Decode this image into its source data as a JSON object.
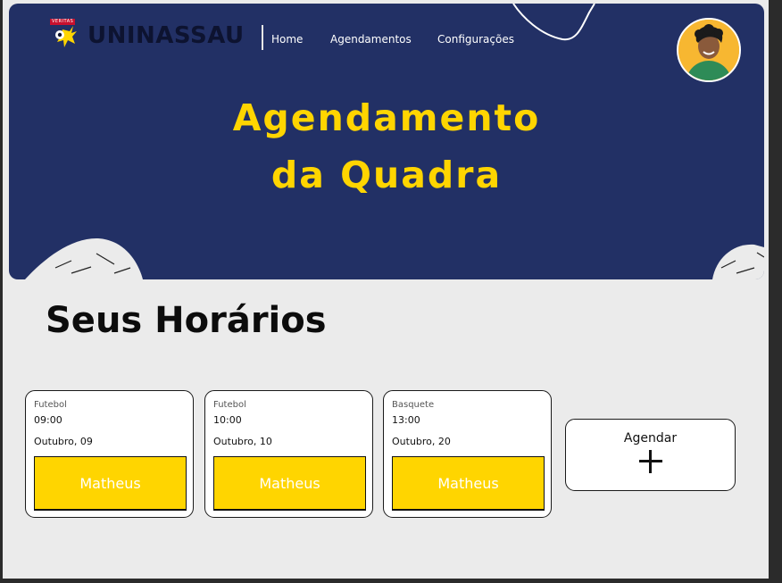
{
  "brand": {
    "name": "UNINASSAU",
    "tag": "VERITAS"
  },
  "nav": {
    "items": [
      {
        "label": "Home"
      },
      {
        "label": "Agendamentos"
      },
      {
        "label": "Configurações"
      }
    ]
  },
  "hero": {
    "title_line1": "Agendamento",
    "title_line2": "da Quadra"
  },
  "section": {
    "title": "Seus Horários"
  },
  "bookings": [
    {
      "sport": "Futebol",
      "time": "09:00",
      "date": "Outubro, 09",
      "name": "Matheus"
    },
    {
      "sport": "Futebol",
      "time": "10:00",
      "date": "Outubro, 10",
      "name": "Matheus"
    },
    {
      "sport": "Basquete",
      "time": "13:00",
      "date": "Outubro, 20",
      "name": "Matheus"
    }
  ],
  "add_card": {
    "label": "Agendar",
    "icon": "plus-icon"
  },
  "colors": {
    "hero_bg": "#223065",
    "accent": "#ffd500",
    "page_bg": "#ebebeb"
  }
}
